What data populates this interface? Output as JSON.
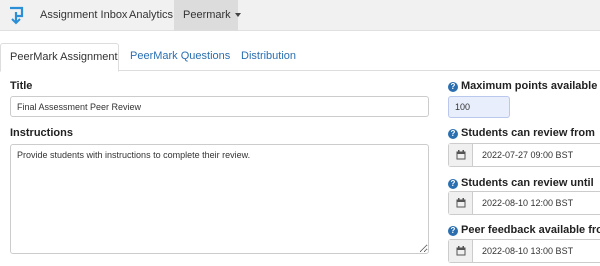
{
  "nav": {
    "logo_icon": "turnitin-logo-icon",
    "items": [
      {
        "label": "Assignment Inbox"
      },
      {
        "label": "Analytics"
      },
      {
        "label": "Peermark"
      }
    ]
  },
  "tabs": [
    {
      "label": "PeerMark Assignment"
    },
    {
      "label": "PeerMark Questions"
    },
    {
      "label": "Distribution"
    }
  ],
  "form": {
    "title_label": "Title",
    "title_value": "Final Assessment Peer Review",
    "instructions_label": "Instructions",
    "instructions_value": "Provide students with instructions to complete their review.",
    "max_points_label": "Maximum points available",
    "max_points_value": "100",
    "review_from_label": "Students can review from",
    "review_from_value": "2022-07-27 09:00 BST",
    "review_until_label": "Students can review until",
    "review_until_value": "2022-08-10 12:00 BST",
    "feedback_from_label": "Peer feedback available from",
    "feedback_from_value": "2022-08-10 13:00 BST"
  },
  "colors": {
    "link": "#2a6fb0",
    "help_icon": "#2a6fb0",
    "points_bg": "#e8eefc"
  }
}
